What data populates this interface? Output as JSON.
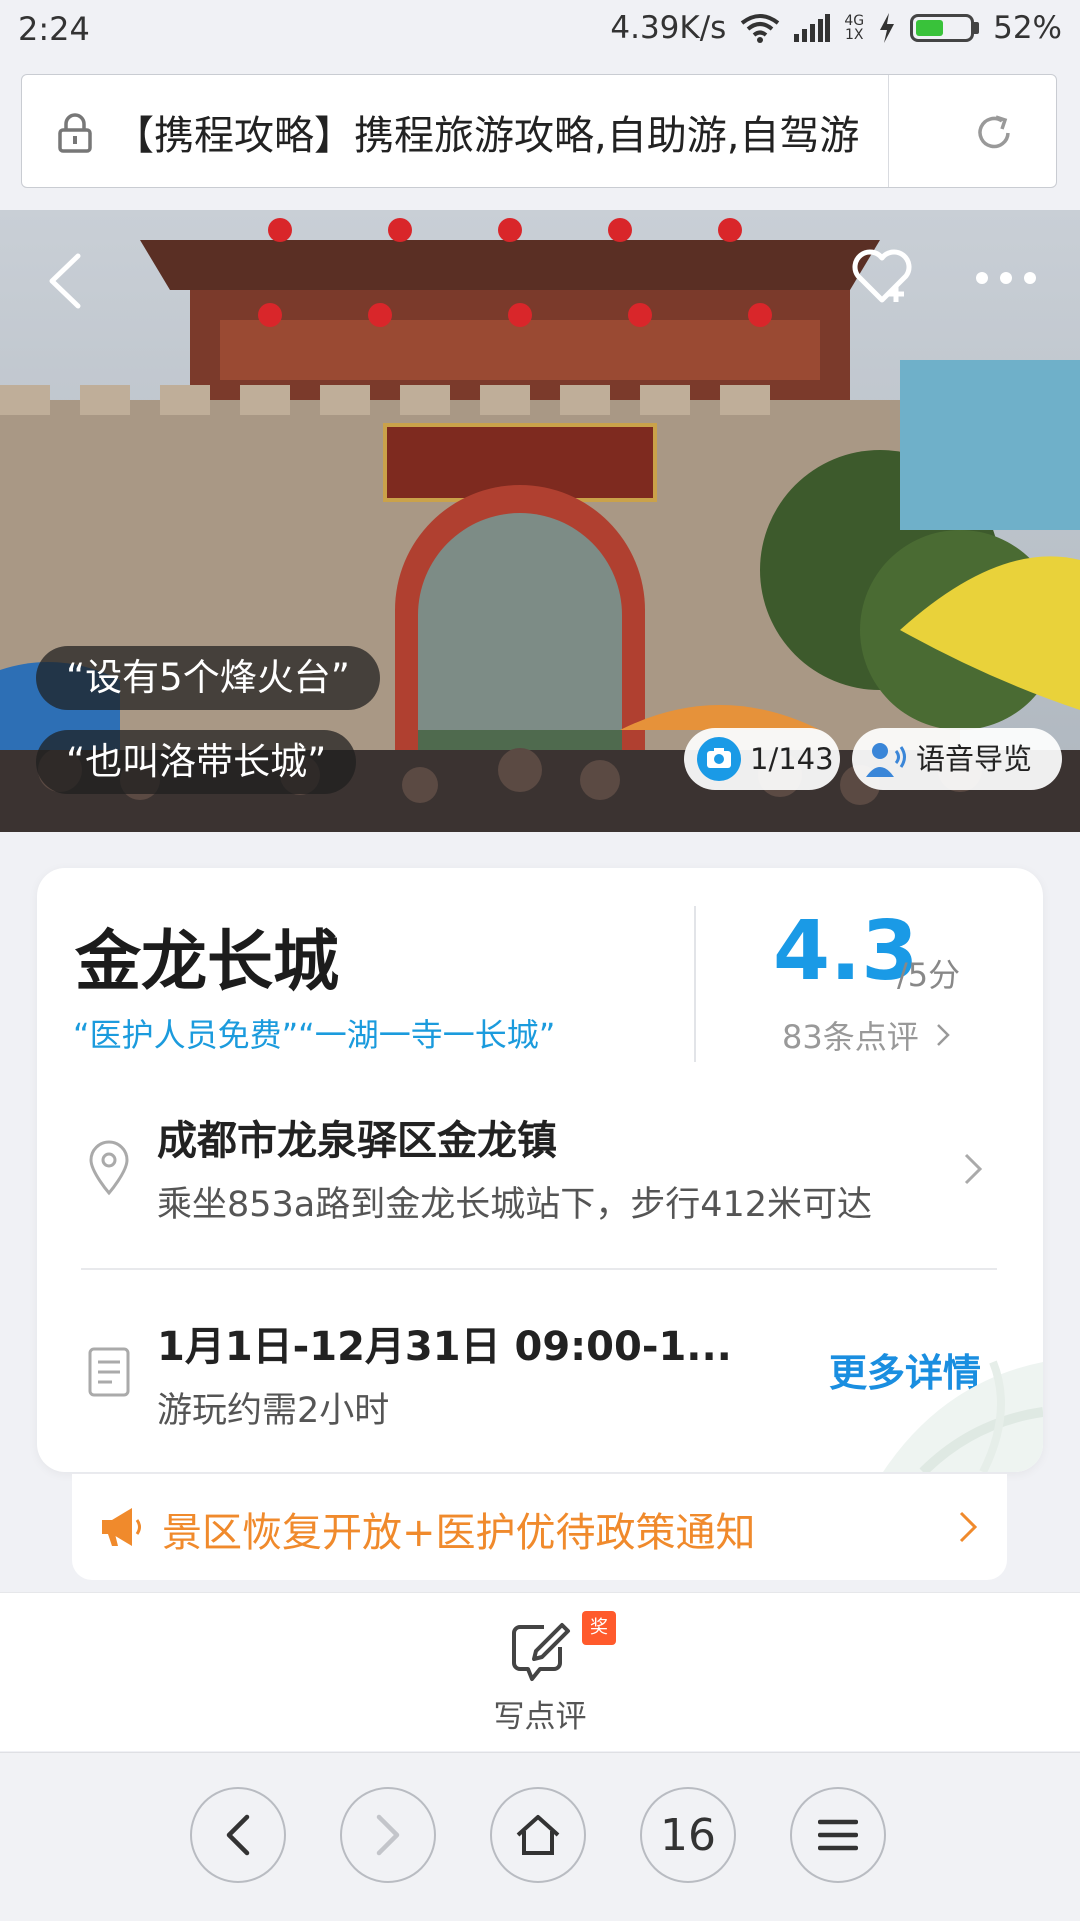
{
  "status_bar": {
    "time": "2:24",
    "network_speed": "4.39K/s",
    "network_type_top": "4G",
    "network_type_bottom": "1X",
    "battery_percent": "52%",
    "battery_level": 0.52,
    "icons": [
      "wifi-icon",
      "signal-icon",
      "charging-icon",
      "battery-icon"
    ]
  },
  "url_bar": {
    "title": "【携程攻略】携程旅游攻略,自助游,自驾游",
    "icons": [
      "lock-icon",
      "reload-icon"
    ]
  },
  "hero": {
    "quote_1": "“设有5个烽火台”",
    "quote_2": "“也叫洛带长城”",
    "photo_count": "1/143",
    "audio_guide": "语音导览",
    "icons": [
      "back-icon",
      "favorite-icon",
      "more-icon",
      "camera-icon",
      "audio-guide-icon"
    ]
  },
  "info_card": {
    "title": "金龙长城",
    "tags": "“医护人员免费”“一湖一寺一长城”",
    "score": "4.3",
    "score_unit": "/5分",
    "reviews": "83条点评",
    "address": "成都市龙泉驿区金龙镇",
    "directions": "乘坐853a路到金龙长城站下，步行412米可达",
    "hours": "1月1日-12月31日 09:00-1...",
    "duration": "游玩约需2小时",
    "more_details": "更多详情"
  },
  "notice": {
    "text": "景区恢复开放+医护优待政策通知"
  },
  "review_bar": {
    "badge": "奖",
    "label": "写点评"
  },
  "nav_bar": {
    "tab_count": "16",
    "icons": [
      "nav-back-icon",
      "nav-forward-icon",
      "home-icon",
      "tabs-icon",
      "menu-icon"
    ]
  },
  "colors": {
    "accent_blue": "#1a9ae6",
    "notice_orange": "#f08a2c",
    "badge_red": "#ff5a2c",
    "battery_green": "#39c23a"
  }
}
